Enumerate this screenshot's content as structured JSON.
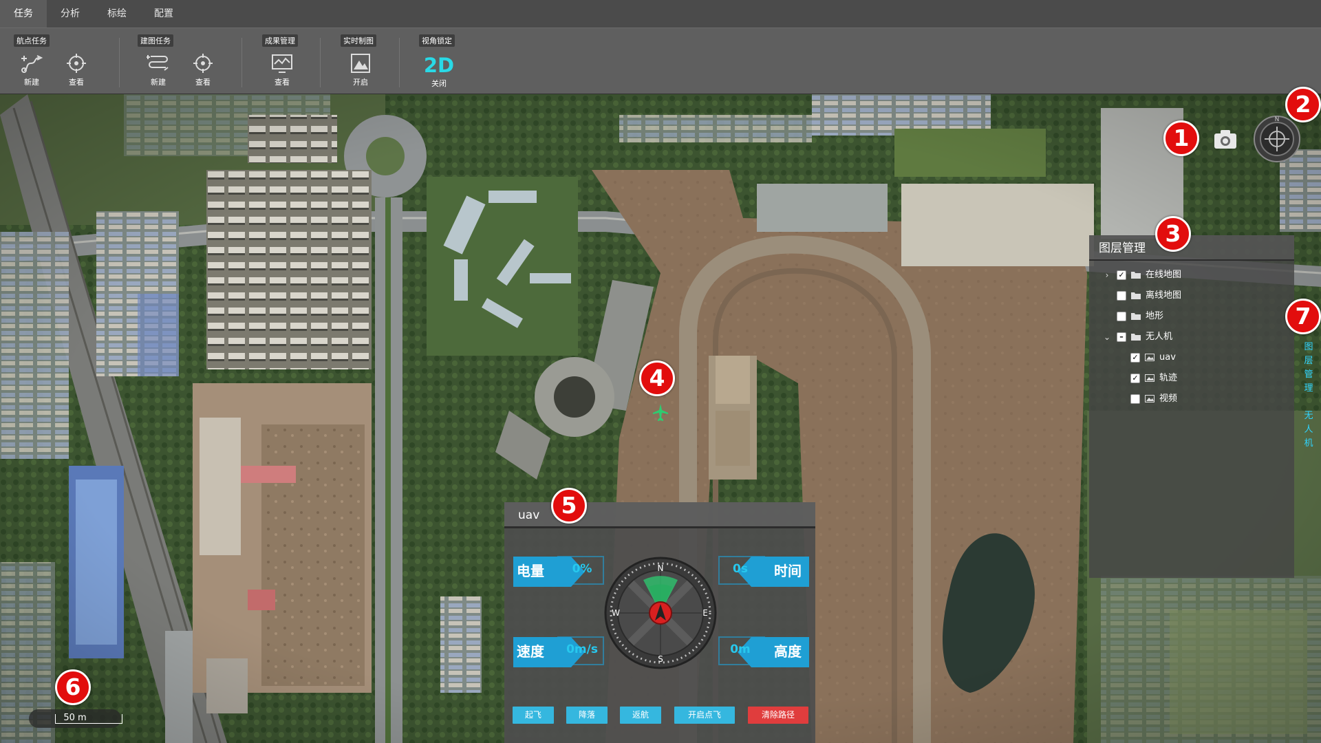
{
  "menu": {
    "tabs": [
      {
        "label": "任务",
        "active": true
      },
      {
        "label": "分析"
      },
      {
        "label": "标绘"
      },
      {
        "label": "配置"
      }
    ]
  },
  "ribbon": {
    "waypoint": {
      "title": "航点任务",
      "new": "新建",
      "view": "查看"
    },
    "mapping": {
      "title": "建图任务",
      "new": "新建",
      "view": "查看"
    },
    "results": {
      "title": "成果管理",
      "view": "查看"
    },
    "realtime": {
      "title": "实时制图",
      "open": "开启"
    },
    "view_lock": {
      "title": "视角锁定",
      "mode": "2D",
      "close": "关闭"
    }
  },
  "markers": [
    "1",
    "2",
    "3",
    "4",
    "5",
    "6",
    "7"
  ],
  "map_tools": {
    "camera_icon": "camera-icon",
    "compass_icon": "compass-icon",
    "north": "N"
  },
  "layer_panel": {
    "title": "图层管理",
    "items": [
      {
        "label": "在线地图",
        "checked": true,
        "expand": "collapsed",
        "type": "folder"
      },
      {
        "label": "离线地图",
        "checked": false,
        "type": "folder"
      },
      {
        "label": "地形",
        "checked": false,
        "type": "folder"
      },
      {
        "label": "无人机",
        "checked": "partial",
        "expand": "expanded",
        "type": "folder"
      },
      {
        "label": "uav",
        "checked": true,
        "type": "image"
      },
      {
        "label": "轨迹",
        "checked": true,
        "type": "image"
      },
      {
        "label": "视频",
        "checked": false,
        "type": "image"
      }
    ]
  },
  "side_tabs": {
    "layers": [
      "图",
      "层",
      "管",
      "理"
    ],
    "uav": [
      "无",
      "人",
      "机"
    ],
    "color": "#2fd4ff"
  },
  "scale": {
    "label": "50 m"
  },
  "uav_panel": {
    "title": "uav",
    "battery": {
      "label": "电量",
      "value": "0%"
    },
    "time": {
      "label": "时间",
      "value": "0s"
    },
    "speed": {
      "label": "速度",
      "value": "0m/s"
    },
    "altitude": {
      "label": "高度",
      "value": "0m"
    },
    "compass": {
      "n": "N",
      "s": "S",
      "e": "E",
      "w": "W"
    },
    "commands": {
      "takeoff": "起飞",
      "land": "降落",
      "return": "返航",
      "waypoint": "开启点飞",
      "clear": "清除路径"
    }
  },
  "colors": {
    "accent": "#35b7df",
    "danger": "#e03d3d",
    "marker": "#e20d0d",
    "drone": "#2ecc71"
  }
}
